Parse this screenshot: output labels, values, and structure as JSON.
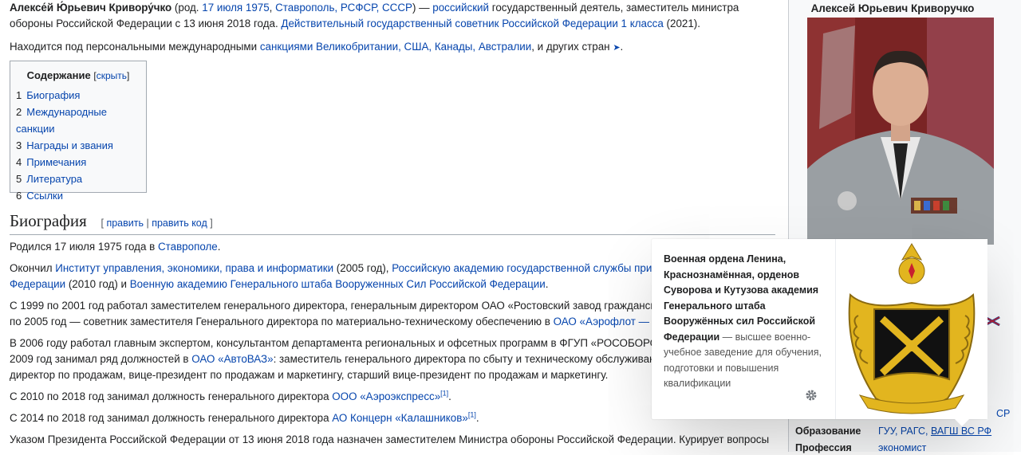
{
  "lead": {
    "name": "Алексе́й Ю́рьевич Кривору́чко",
    "born_prefix": " (род. ",
    "born_date": "17 июля 1975",
    "comma1": ", ",
    "born_place": "Ставрополь, РСФСР, СССР",
    "dash": ") — ",
    "nationality": "российский",
    "desc1": " государственный деятель, заместитель министра обороны Российской Федерации с 13 июня 2018 года. ",
    "rank_link": "Действительный государственный советник Российской Федерации 1 класса",
    "rank_year": " (2021)."
  },
  "sanctions": {
    "prefix": "Находится под персональными международными ",
    "link": "санкциями Великобритании, США, Канады, Австралии",
    "suffix": ", и других стран ",
    "arrow": "➤",
    "end": "."
  },
  "toc": {
    "title": "Содержание",
    "toggle": "скрыть",
    "items": [
      {
        "num": "1",
        "label": "Биография"
      },
      {
        "num": "2",
        "label": "Международные санкции"
      },
      {
        "num": "3",
        "label": "Награды и звания"
      },
      {
        "num": "4",
        "label": "Примечания"
      },
      {
        "num": "5",
        "label": "Литература"
      },
      {
        "num": "6",
        "label": "Ссылки"
      }
    ]
  },
  "section": {
    "title": "Биография",
    "edit": "править",
    "edit_code": "править код"
  },
  "bio": {
    "p1_text": "Родился 17 июля 1975 года в ",
    "p1_link": "Ставрополе",
    "p1_end": ".",
    "p2_a": "Окончил ",
    "p2_link1": "Институт управления, экономики, права и информатики",
    "p2_b": " (2005 год), ",
    "p2_link2": "Российскую академию государственной службы при Пр",
    "p2_link2b": "Федерации",
    "p2_c": " (2010 год) и ",
    "p2_link3": "Военную академию Генерального штаба Вооруженных Сил Российской Федерации",
    "p2_end": ".",
    "p3_a": "С 1999 по 2001 год работал заместителем генерального директора, генеральным директором ОАО «Ростовский завод гражданской",
    "p3_b": "по 2005 год — советник заместителя Генерального директора по материально-техническому обеспечению в ",
    "p3_link": "ОАО «Аэрофлот — Рос",
    "p4_a": "В 2006 году работал главным экспертом, консультантом департамента региональных и офсетных программ в ФГУП «РОСОБОРОН",
    "p4_b": "2009 год занимал ряд должностей в ",
    "p4_link": "ОАО «АвтоВАЗ»",
    "p4_c": ": заместитель генерального директора по сбыту и техническому обслуживани",
    "p4_d": "директор по продажам, вице-президент по продажам и маркетингу, старший вице-президент по продажам и маркетингу.",
    "p5_a": "С 2010 по 2018 год занимал должность генерального директора ",
    "p5_link": "ООО «Аэроэкспресс»",
    "p5_ref": "[1]",
    "p5_end": ".",
    "p6_a": "С 2014 по 2018 год занимал должность генерального директора ",
    "p6_link": "АО Концерн «Калашников»",
    "p6_ref": "[1]",
    "p6_end": ".",
    "p7_a": "Указом Президента Российской Федерации от 13 июня 2018 года назначен заместителем Министра обороны Российской Федерации. Курирует вопросы"
  },
  "infobox": {
    "title": "Алексей Юрьевич Криворучко",
    "frag_src": "СР",
    "education_label": "Образование",
    "education_a": "ГУУ, РАГС, ",
    "education_link": "ВАГШ ВС РФ",
    "profession_label": "Профессия",
    "profession_value": "экономист"
  },
  "popup": {
    "title": "Военная ордена Ленина, Краснознамённая, орденов Суворова и Кутузова академия Генерального штаба Вооружённых сил Российской Федерации",
    "desc": " — высшее военно-учебное заведение для обучения, подготовки и повышения квалификации",
    "gear_icon": "gear-icon"
  },
  "colors": {
    "link": "#0645ad",
    "text": "#202122",
    "emblem_gold": "#e2b51f",
    "emblem_black": "#111111"
  }
}
